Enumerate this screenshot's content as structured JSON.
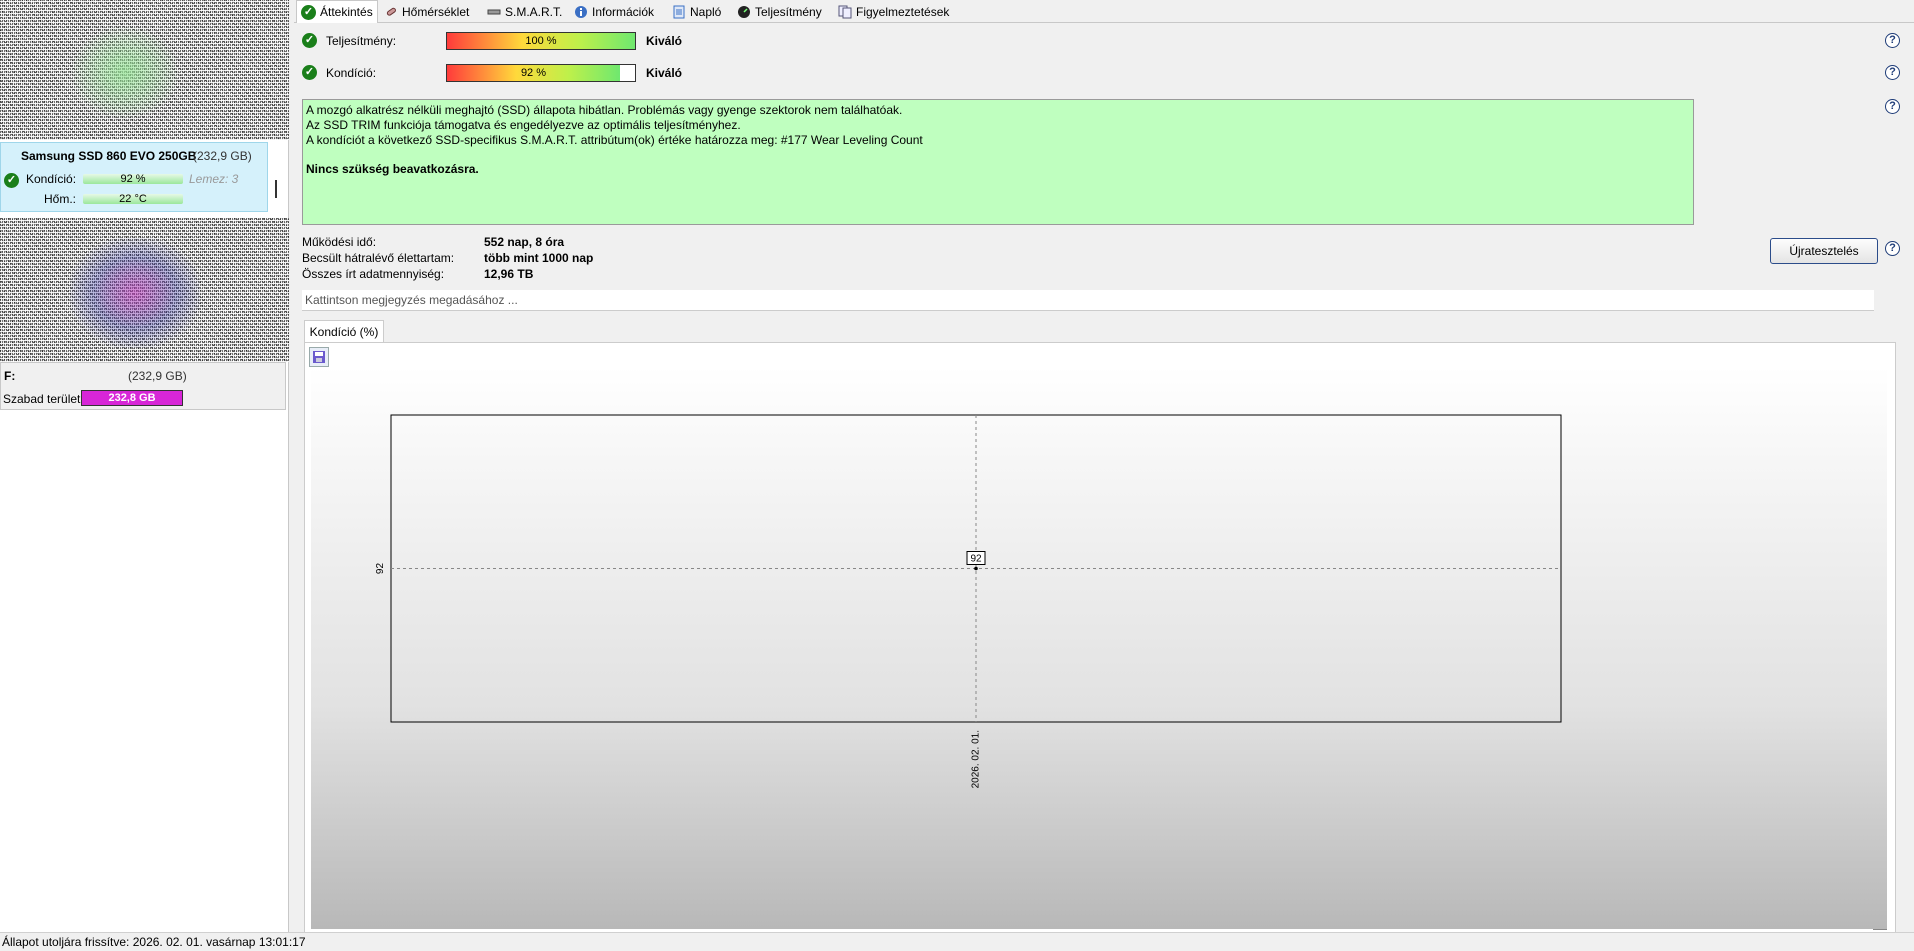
{
  "tabs": [
    {
      "label": "Áttekintés",
      "icon": "check-circle-icon",
      "active": true
    },
    {
      "label": "Hőmérséklet",
      "icon": "thermometer-icon"
    },
    {
      "label": "S.M.A.R.T.",
      "icon": "drive-icon"
    },
    {
      "label": "Információk",
      "icon": "info-icon"
    },
    {
      "label": "Napló",
      "icon": "log-icon"
    },
    {
      "label": "Teljesítmény",
      "icon": "gauge-icon"
    },
    {
      "label": "Figyelmeztetések",
      "icon": "alerts-icon"
    }
  ],
  "sidebar": {
    "drive": {
      "name": "Samsung SSD 860 EVO 250GB",
      "size": "(232,9 GB)",
      "health_label": "Kondíció:",
      "health_value": "92 %",
      "health_fraction": 0.92,
      "disk_label": "Lemez: 3",
      "temp_label": "Hőm.:",
      "temp_value": "22 °C"
    },
    "volume": {
      "letter": "F:",
      "size": "(232,9 GB)",
      "free_label": "Szabad terület",
      "free_value": "232,8 GB"
    }
  },
  "overview": {
    "performance": {
      "label": "Teljesítmény:",
      "value": "100 %",
      "fraction": 1.0,
      "rating": "Kiváló"
    },
    "health": {
      "label": "Kondíció:",
      "value": "92 %",
      "fraction": 0.92,
      "rating": "Kiváló"
    },
    "info_lines": [
      "A mozgó alkatrész nélküli meghajtó (SSD) állapota hibátlan. Problémás vagy gyenge szektorok nem találhatóak.",
      "Az SSD TRIM funkciója támogatva és engedélyezve az optimális teljesítményhez.",
      "A kondíciót a következő SSD-specifikus S.M.A.R.T. attribútum(ok) értéke határozza meg:  #177 Wear Leveling Count"
    ],
    "info_bold": "Nincs szükség beavatkozásra.",
    "stats": [
      {
        "label": "Működési idő:",
        "value": "552 nap, 8 óra"
      },
      {
        "label": "Becsült hátralévő élettartam:",
        "value": "több mint 1000 nap"
      },
      {
        "label": "Összes írt adatmennyiség:",
        "value": "12,96 TB"
      }
    ],
    "retest_label": "Újratesztelés",
    "note_placeholder": "Kattintson megjegyzés megadásához ...",
    "chart_tab": "Kondíció  (%)"
  },
  "chart_data": {
    "type": "line",
    "title": "",
    "xlabel": "",
    "ylabel": "",
    "x": [
      "2026. 02. 01."
    ],
    "series": [
      {
        "values": [
          92
        ]
      }
    ],
    "y_ticks": [
      "92"
    ],
    "data_labels": [
      "92"
    ],
    "grid": true
  },
  "status": "Állapot utoljára frissítve: 2026. 02. 01. vasárnap 13:01:17",
  "colors": {
    "info_bg": "#bfffbf",
    "free_bar": "#d726d7",
    "ok_green": "#1a7f1a"
  }
}
